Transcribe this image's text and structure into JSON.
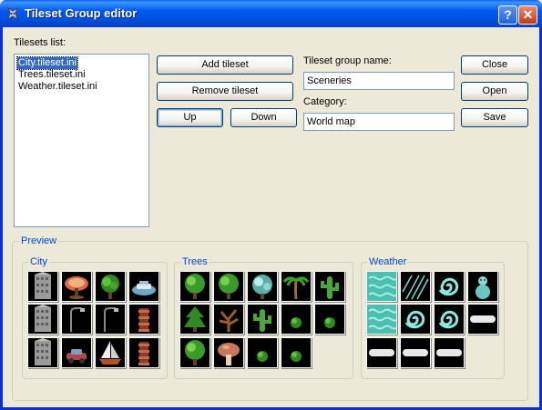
{
  "window": {
    "title": "Tileset Group editor",
    "help_glyph": "?",
    "close_glyph": "✕"
  },
  "tilesets": {
    "label": "Tilesets list:",
    "items": [
      "City.tileset.ini",
      "Trees.tileset.ini",
      "Weather.tileset.ini"
    ],
    "selected_index": 0
  },
  "buttons": {
    "add_tileset": "Add tileset",
    "remove_tileset": "Remove tileset",
    "up": "Up",
    "down": "Down",
    "close": "Close",
    "open": "Open",
    "save": "Save"
  },
  "fields": {
    "group_name_label": "Tileset group name:",
    "group_name_value": "Sceneries",
    "category_label": "Category:",
    "category_value": "World map"
  },
  "preview": {
    "label": "Preview",
    "groups": [
      {
        "title": "City",
        "tiles": [
          "building-gray",
          "cafe-table",
          "tree-bush",
          "boat-car",
          "building-gray",
          "street-lamp",
          "street-lamp",
          "tower-red",
          "building-gray",
          "car",
          "sailboat",
          "tower-red"
        ]
      },
      {
        "title": "Trees",
        "tiles": [
          "round-tree",
          "round-tree",
          "frost-tree",
          "palm-tree",
          "cactus",
          "pine-tree",
          "dead-tree",
          "cactus",
          "small-bush",
          "small-bush",
          "round-tree",
          "mushroom",
          "small-bush",
          "small-bush"
        ]
      },
      {
        "title": "Weather",
        "tiles": [
          "water",
          "rain",
          "swirl",
          "snowman",
          "water",
          "swirl",
          "swirl",
          "cloud",
          "cloud",
          "cloud",
          "cloud"
        ]
      }
    ]
  },
  "colors": {
    "accent": "#0046D5",
    "selection": "#316AC5",
    "titlebar": "#0058EE"
  }
}
